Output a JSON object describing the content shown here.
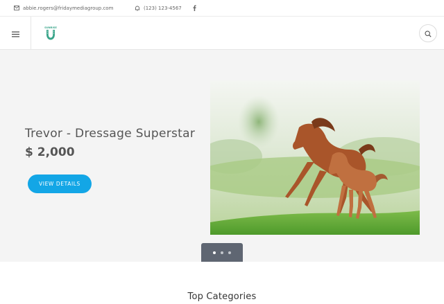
{
  "topbar": {
    "email": "abbie.rogers@fridaymediagroup.com",
    "phone": "(123) 123-4567",
    "icons": {
      "email": "envelope-icon",
      "phone": "bell-icon",
      "social": "facebook-icon"
    }
  },
  "header": {
    "logo_text": "SUNRISE",
    "icons": {
      "menu": "hamburger-menu-icon",
      "search": "search-icon"
    }
  },
  "hero": {
    "title": "Trevor - Dressage Superstar",
    "price": "$ 2,000",
    "button_label": "VIEW DETAILS",
    "image": "horses-galloping-photo",
    "slides": {
      "count": 3,
      "active": 1
    }
  },
  "sections": {
    "top_categories_title": "Top Categories"
  },
  "colors": {
    "accent": "#13a6e6",
    "logo_green": "#3aa58a",
    "hero_bg": "#f4f4f4",
    "slider_tab": "#5f6672"
  }
}
